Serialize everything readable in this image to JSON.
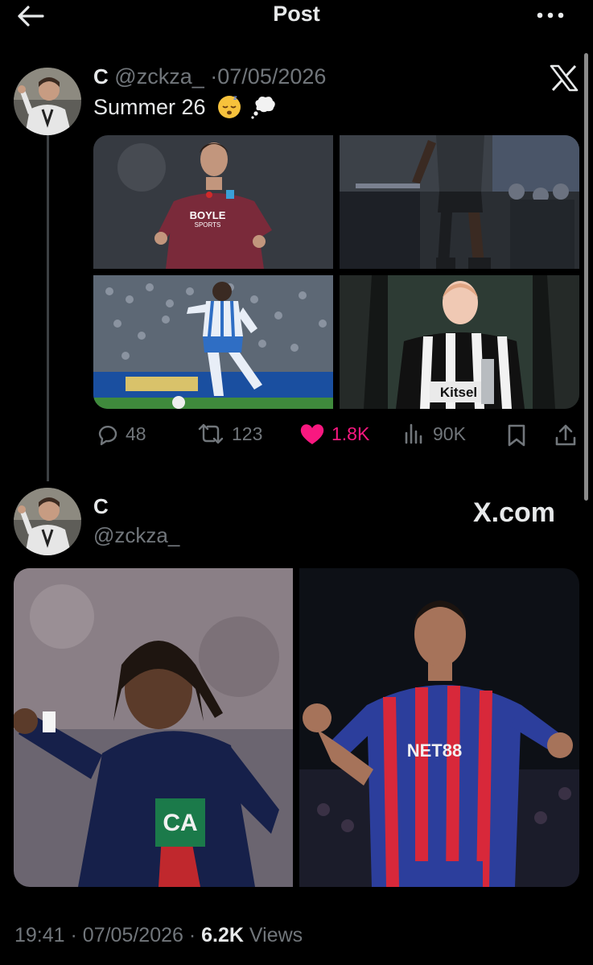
{
  "header": {
    "title": "Post",
    "back_icon": "arrow-left-icon",
    "more_icon": "more-horizontal-icon"
  },
  "tweet": {
    "author_name": "C",
    "handle": "@zckza_",
    "separator": "·",
    "date": "07/05/2026",
    "text": "Summer 26",
    "emojis": [
      "sleeping-face-emoji",
      "thought-balloon-emoji"
    ],
    "source_icon": "x-logo-icon",
    "media": [
      {
        "name": "player-west-ham-kit",
        "sponsor": "BOYLE SPORTS"
      },
      {
        "name": "player-real-madrid-dark-kit"
      },
      {
        "name": "player-brighton-kit"
      },
      {
        "name": "player-newcastle-kit",
        "sponsor": "Kitsel"
      }
    ],
    "actions": {
      "replies": "48",
      "retweets": "123",
      "likes": "1.8K",
      "views": "90K",
      "like_color": "#f91880"
    }
  },
  "link_card": {
    "name": "C",
    "handle": "@zckza_",
    "site": "X.com",
    "media": [
      {
        "name": "player-psg-kit",
        "sponsor": "CA"
      },
      {
        "name": "player-crystal-palace-kit",
        "sponsor": "NET88"
      }
    ]
  },
  "footer": {
    "time": "19:41",
    "separator": "·",
    "date": "07/05/2026",
    "separator2": "·",
    "views_count": "6.2K",
    "views_label": "Views"
  }
}
